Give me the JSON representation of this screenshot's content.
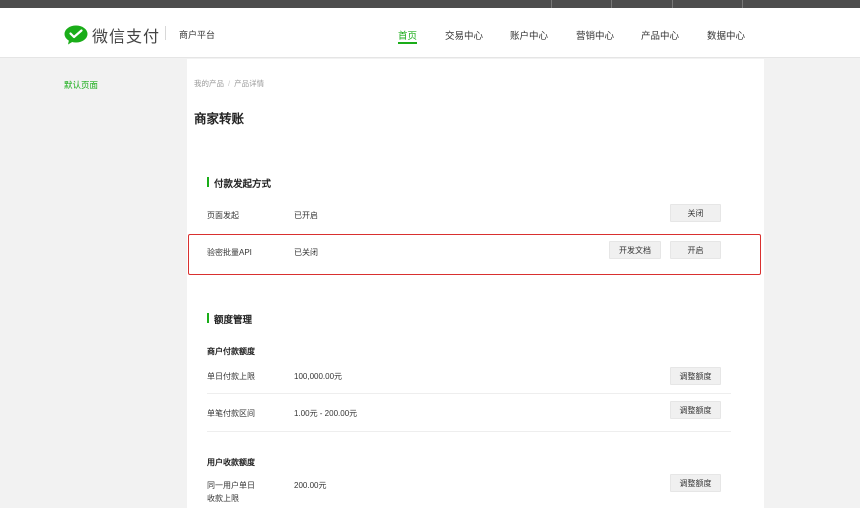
{
  "header": {
    "logo_text": "微信支付",
    "platform": "商户平台",
    "nav": [
      {
        "label": "首页",
        "active": true
      },
      {
        "label": "交易中心",
        "active": false
      },
      {
        "label": "账户中心",
        "active": false
      },
      {
        "label": "营销中心",
        "active": false
      },
      {
        "label": "产品中心",
        "active": false
      },
      {
        "label": "数据中心",
        "active": false
      }
    ],
    "accent_color": "#1aad19"
  },
  "sidebar": {
    "items": [
      {
        "label": "默认页面"
      }
    ]
  },
  "breadcrumb": {
    "items": [
      "我的产品",
      "产品详情"
    ],
    "separator": "/"
  },
  "page_title": "商家转账",
  "payment_methods": {
    "title": "付款发起方式",
    "rows": [
      {
        "label": "页面发起",
        "status": "已开启",
        "action": "关闭"
      },
      {
        "label": "验密批量API",
        "status": "已关闭",
        "doc_button": "开发文档",
        "action": "开启"
      }
    ]
  },
  "quota": {
    "title": "额度管理",
    "merchant": {
      "heading": "商户付款额度",
      "rows": [
        {
          "label": "单日付款上限",
          "value": "100,000.00元",
          "action": "调整额度"
        },
        {
          "label": "单笔付款区间",
          "value": "1.00元 - 200.00元",
          "action": "调整额度"
        }
      ]
    },
    "user": {
      "heading": "用户收款额度",
      "rows": [
        {
          "label_line1": "同一用户单日",
          "label_line2": "收款上限",
          "value": "200.00元",
          "action": "调整额度"
        }
      ]
    }
  },
  "highlight_color": "#d9302f"
}
